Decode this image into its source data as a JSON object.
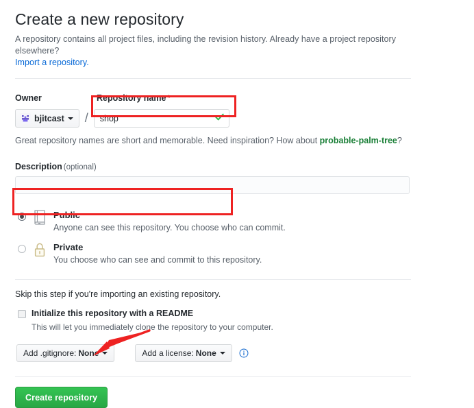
{
  "header": {
    "title": "Create a new repository",
    "subtitle": "A repository contains all project files, including the revision history. Already have a project repository elsewhere?",
    "import_link": "Import a repository."
  },
  "owner": {
    "label": "Owner",
    "name": "bjitcast",
    "avatar_icon": "identicon-avatar",
    "caret_icon": "chevron-down-icon",
    "separator": "/"
  },
  "repository_name": {
    "label": "Repository name",
    "required_marker": "*",
    "value": "shop",
    "placeholder": "",
    "valid_icon": "check-icon",
    "hint_prefix": "Great repository names are short and memorable. Need inspiration? How about ",
    "hint_suggestion": "probable-palm-tree",
    "hint_suffix": "?"
  },
  "description": {
    "label": "Description",
    "optional_note": "(optional)",
    "value": "",
    "placeholder": ""
  },
  "visibility": {
    "options": [
      {
        "id": "public",
        "title": "Public",
        "description": "Anyone can see this repository. You choose who can commit.",
        "icon": "repo-book-icon",
        "selected": true
      },
      {
        "id": "private",
        "title": "Private",
        "description": "You choose who can see and commit to this repository.",
        "icon": "lock-icon",
        "selected": false
      }
    ]
  },
  "initialize": {
    "skip_text": "Skip this step if you're importing an existing repository.",
    "readme_label": "Initialize this repository with a README",
    "readme_desc": "This will let you immediately clone the repository to your computer.",
    "readme_checked": false,
    "gitignore": {
      "label": "Add .gitignore:",
      "value": "None",
      "caret_icon": "chevron-down-icon"
    },
    "license": {
      "label": "Add a license:",
      "value": "None",
      "caret_icon": "chevron-down-icon"
    },
    "info_icon": "info-icon"
  },
  "submit": {
    "label": "Create repository"
  },
  "annotations": {
    "highlight_color": "#ee2222",
    "boxes": [
      "repository-name-field",
      "public-visibility-option"
    ],
    "arrow_target": "create-repository-button"
  },
  "colors": {
    "accent_blue": "#0366d6",
    "success_green": "#2cbe4e",
    "button_green": "#28a745",
    "required_red": "#cb2431",
    "text_primary": "#24292e",
    "text_muted": "#586069"
  }
}
